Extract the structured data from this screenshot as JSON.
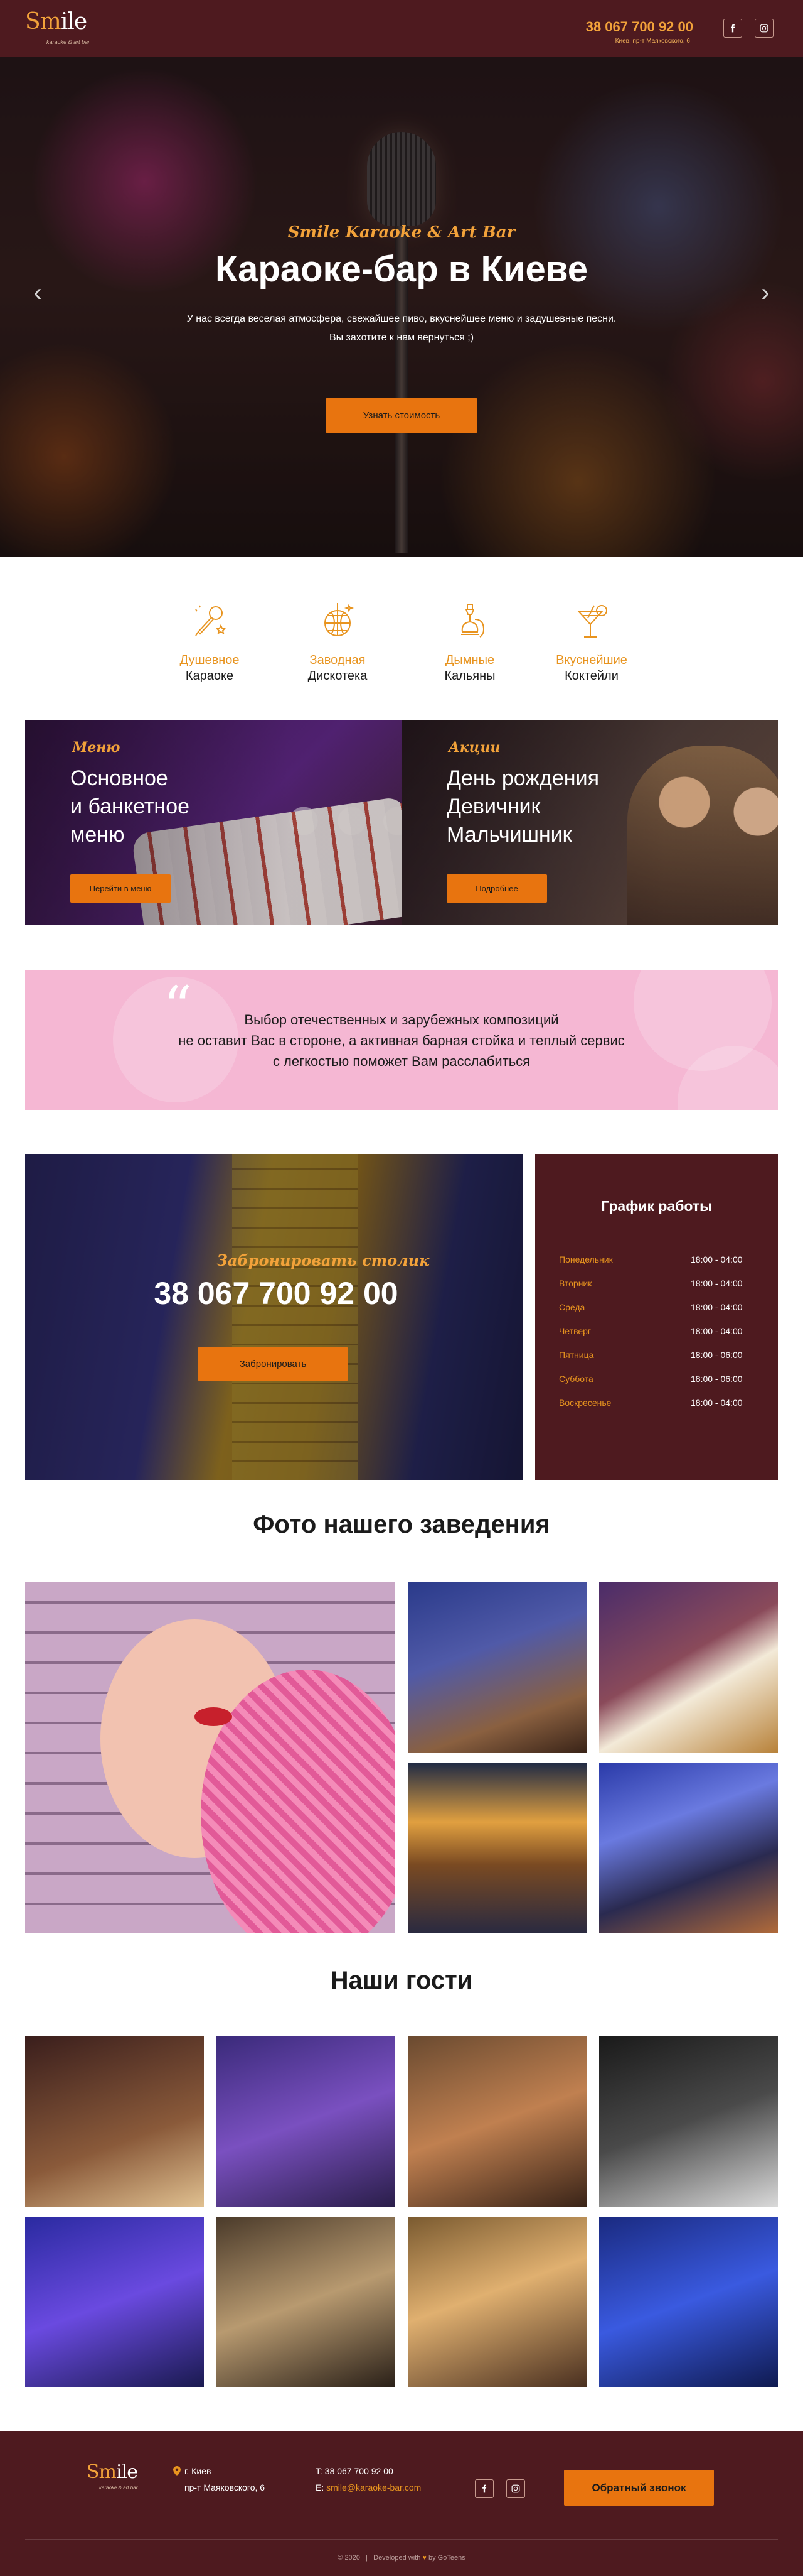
{
  "header": {
    "logo": {
      "word_first": "Sm",
      "word_accent": "i",
      "word_rest": "le",
      "subtitle": "karaoke & art bar"
    },
    "phone": "38 067 700 92 00",
    "address": "Киев, пр-т Маяковского, 6",
    "social": {
      "facebook_icon": "facebook-icon",
      "instagram_icon": "instagram-icon"
    }
  },
  "hero": {
    "script_title": "Smile Karaoke & Art Bar",
    "title": "Караоке-бар в Киеве",
    "description": "У нас всегда веселая атмосфера, свежайшее пиво, вкуснейшее меню и задушевные песни. Вы захотите к нам вернуться ;)",
    "button_label": "Узнать стоимость",
    "prev_arrow": "‹",
    "next_arrow": "›"
  },
  "features": [
    {
      "icon": "microphone-icon",
      "line1": "Душевное",
      "line2": "Караоке"
    },
    {
      "icon": "disco-ball-icon",
      "line1": "Заводная",
      "line2": "Дискотека"
    },
    {
      "icon": "hookah-icon",
      "line1": "Дымные",
      "line2": "Кальяны"
    },
    {
      "icon": "cocktail-icon",
      "line1": "Вкуснейшие",
      "line2": "Коктейли"
    }
  ],
  "cards": {
    "menu": {
      "tag": "Меню",
      "title_lines": [
        "Основное",
        "и банкетное",
        "меню"
      ],
      "button_label": "Перейти в меню"
    },
    "promo": {
      "tag": "Акции",
      "title_lines": [
        "День рождения",
        "Девичник",
        "Мальчишник"
      ],
      "button_label": "Подробнее"
    }
  },
  "quote": {
    "mark": "“",
    "lines": [
      "Выбор отечественных и зарубежных композиций",
      "не оставит Вас в стороне, а активная барная стойка и теплый сервис",
      "с легкостью поможет Вам расслабиться"
    ]
  },
  "booking": {
    "script_title": "Забронировать столик",
    "phone": "38 067 700 92 00",
    "button_label": "Забронировать"
  },
  "schedule": {
    "title": "График работы",
    "rows": [
      {
        "day": "Понедельник",
        "time": "18:00 - 04:00"
      },
      {
        "day": "Вторник",
        "time": "18:00 - 04:00"
      },
      {
        "day": "Среда",
        "time": "18:00 - 04:00"
      },
      {
        "day": "Четверг",
        "time": "18:00 - 04:00"
      },
      {
        "day": "Пятница",
        "time": "18:00 - 06:00"
      },
      {
        "day": "Суббота",
        "time": "18:00 - 06:00"
      },
      {
        "day": "Воскресенье",
        "time": "18:00 - 04:00"
      }
    ]
  },
  "gallery": {
    "title": "Фото нашего заведения"
  },
  "guests": {
    "title": "Наши гости"
  },
  "footer": {
    "city": "г. Киев",
    "street": "пр-т Маяковского, 6",
    "tel_label": "T:",
    "tel": "38 067 700 92 00",
    "email_label": "E:",
    "email": "smile@karaoke-bar.com",
    "button_label": "Обратный звонок",
    "copyright": "© 2020",
    "developed_with": "Developed with",
    "heart": "♥",
    "developer": "by GoTeens"
  },
  "colors": {
    "brand_dark": "#4e1a1f",
    "accent": "#e8740f",
    "accent_text": "#e8941f",
    "quote_bg": "#f5b7d3"
  }
}
